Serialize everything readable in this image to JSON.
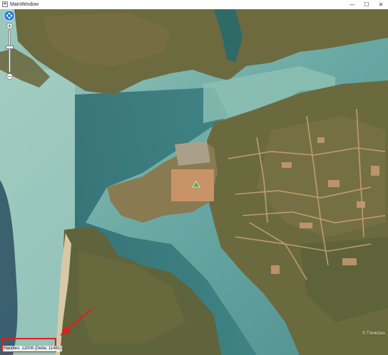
{
  "window": {
    "title": "MainWindow",
    "minimize_glyph": "—",
    "maximize_glyph": "☐",
    "close_glyph": "✕"
  },
  "map": {
    "imagery": "aerial satellite",
    "colors": {
      "shallow_water": "#8fc3b5",
      "deep_water": "#2f6f72",
      "land": "#6b6a3e",
      "bare_ground": "#c49a70"
    }
  },
  "zoom_control": {
    "pan_icon": "pan-arrows-icon",
    "zoom_in_label": "+",
    "zoom_out_label": "−"
  },
  "status": {
    "handles_text": "Handles: 12008 (Delta: 11481)"
  },
  "watermark": {
    "text": "© ThinkGeo"
  },
  "annotation": {
    "highlight_color": "#e01e1e"
  }
}
